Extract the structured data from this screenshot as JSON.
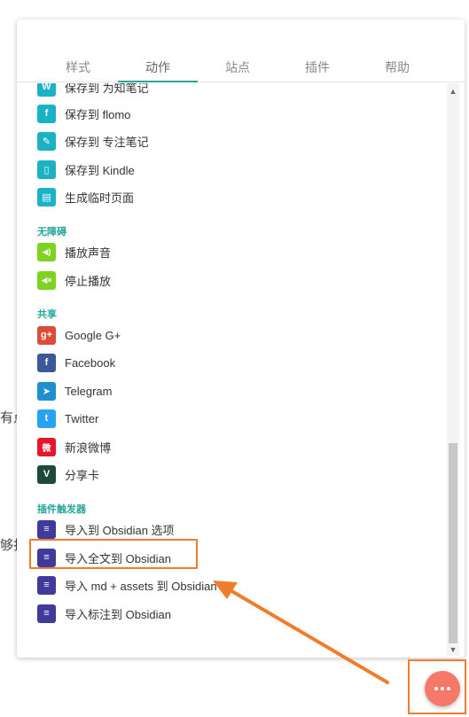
{
  "background": {
    "frag1": "有点",
    "frag2": "够打"
  },
  "tabs": [
    {
      "label": "样式"
    },
    {
      "label": "动作"
    },
    {
      "label": "站点"
    },
    {
      "label": "插件"
    },
    {
      "label": "帮助"
    }
  ],
  "active_tab": "动作",
  "top_items": [
    {
      "label": "保存到 为知笔记",
      "icon": "wiz-icon",
      "glyph": "W",
      "color": "#1ab2c4"
    },
    {
      "label": "保存到 flomo",
      "icon": "flomo-icon",
      "glyph": "f",
      "color": "#1ab2c4"
    },
    {
      "label": "保存到 专注笔记",
      "icon": "leaf-icon",
      "glyph": "✎",
      "color": "#1ab2c4"
    },
    {
      "label": "保存到 Kindle",
      "icon": "kindle-icon",
      "glyph": "▯",
      "color": "#1ab2c4"
    },
    {
      "label": "生成临时页面",
      "icon": "page-icon",
      "glyph": "▤",
      "color": "#1ab2c4"
    }
  ],
  "sections": {
    "accessibility": "无障碍",
    "share": "共享",
    "plugin_triggers": "插件触发器"
  },
  "accessibility_items": [
    {
      "label": "播放声音",
      "icon": "speaker-icon",
      "glyph": "◀)",
      "color": "#7ed321"
    },
    {
      "label": "停止播放",
      "icon": "mute-icon",
      "glyph": "◀×",
      "color": "#7ed321"
    }
  ],
  "share_items": [
    {
      "label": "Google G+",
      "icon": "google-plus-icon",
      "glyph": "g+",
      "color": "#dd4b39"
    },
    {
      "label": "Facebook",
      "icon": "facebook-icon",
      "glyph": "f",
      "color": "#3b5998"
    },
    {
      "label": "Telegram",
      "icon": "telegram-icon",
      "glyph": "➤",
      "color": "#1f8fd0"
    },
    {
      "label": "Twitter",
      "icon": "twitter-icon",
      "glyph": "t",
      "color": "#28a3ef"
    },
    {
      "label": "新浪微博",
      "icon": "weibo-icon",
      "glyph": "微",
      "color": "#e6162d"
    },
    {
      "label": "分享卡",
      "icon": "share-card-icon",
      "glyph": "V",
      "color": "#1d4a3a"
    }
  ],
  "plugin_items": [
    {
      "label": "导入到 Obsidian 选项",
      "icon": "obsidian-icon",
      "glyph": "≡",
      "color": "#3f3a9c"
    },
    {
      "label": "导入全文到 Obsidian",
      "icon": "obsidian-icon",
      "glyph": "≡",
      "color": "#3f3a9c"
    },
    {
      "label": "导入 md + assets 到 Obsidian",
      "icon": "obsidian-icon",
      "glyph": "≡",
      "color": "#3f3a9c"
    },
    {
      "label": "导入标注到 Obsidian",
      "icon": "obsidian-icon",
      "glyph": "≡",
      "color": "#3f3a9c"
    }
  ],
  "colors": {
    "accent": "#26a69a",
    "highlight": "#ef7d2b",
    "fab": "#f57869"
  }
}
